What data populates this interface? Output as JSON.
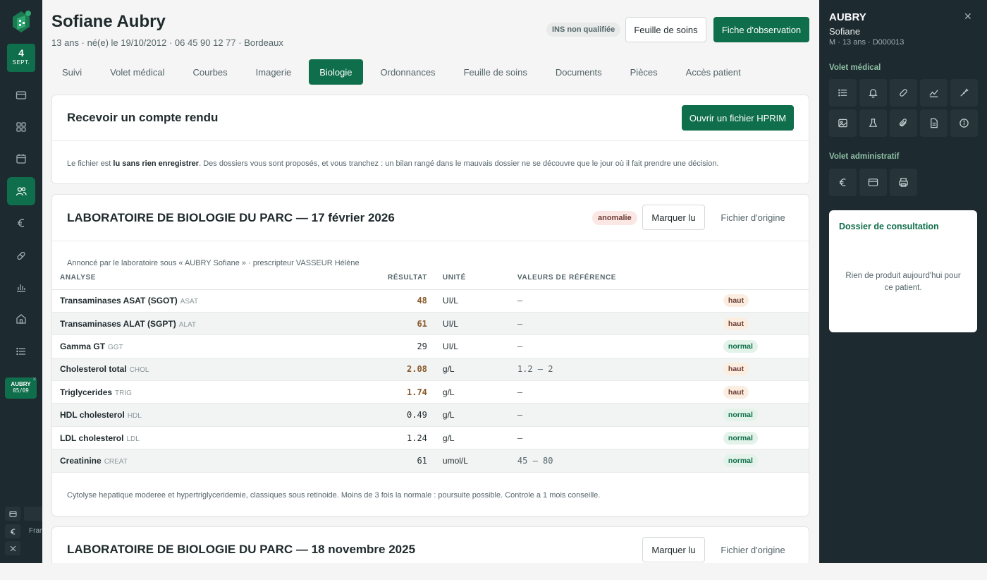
{
  "rail": {
    "date_day": "4",
    "date_month": "SEPT.",
    "patient_chip_name": "AUBRY",
    "patient_chip_date": "05/09",
    "lang_label": "Fran"
  },
  "patient": {
    "name": "Sofiane Aubry",
    "subtitle": "13 ans · né(e) le 19/10/2012 · 06 45 90 12 77 · Bordeaux",
    "ins_badge": "INS non qualifiée"
  },
  "header_buttons": {
    "feuille": "Feuille de soins",
    "fiche": "Fiche d'observation"
  },
  "tabs": [
    {
      "label": "Suivi"
    },
    {
      "label": "Volet médical"
    },
    {
      "label": "Courbes"
    },
    {
      "label": "Imagerie"
    },
    {
      "label": "Biologie"
    },
    {
      "label": "Ordonnances"
    },
    {
      "label": "Feuille de soins"
    },
    {
      "label": "Documents"
    },
    {
      "label": "Pièces"
    },
    {
      "label": "Accès patient"
    }
  ],
  "receive": {
    "title": "Recevoir un compte rendu",
    "button": "Ouvrir un fichier HPRIM",
    "text_before": "Le fichier est ",
    "text_bold": "lu sans rien enregistrer",
    "text_after": ". Des dossiers vous sont proposés, et vous tranchez : un bilan rangé dans le mauvais dossier ne se découvre que le jour où il fait prendre une décision."
  },
  "report1": {
    "title": "LABORATOIRE DE BIOLOGIE DU PARC — 17 février 2026",
    "badge": "anomalie",
    "mark_read": "Marquer lu",
    "origin": "Fichier d'origine",
    "announced": "Annoncé par le laboratoire sous « AUBRY Sofiane » · prescripteur VASSEUR Hélène",
    "headers": {
      "analyse": "ANALYSE",
      "resultat": "RÉSULTAT",
      "unite": "UNITÉ",
      "ref": "VALEURS DE RÉFÉRENCE"
    },
    "rows": [
      {
        "name": "Transaminases ASAT (SGOT)",
        "code": "ASAT",
        "value": "48",
        "unit": "UI/L",
        "ref": "–",
        "flag": "haut"
      },
      {
        "name": "Transaminases ALAT (SGPT)",
        "code": "ALAT",
        "value": "61",
        "unit": "UI/L",
        "ref": "–",
        "flag": "haut"
      },
      {
        "name": "Gamma GT",
        "code": "GGT",
        "value": "29",
        "unit": "UI/L",
        "ref": "–",
        "flag": "normal"
      },
      {
        "name": "Cholesterol total",
        "code": "CHOL",
        "value": "2.08",
        "unit": "g/L",
        "ref": "1.2 – 2",
        "flag": "haut"
      },
      {
        "name": "Triglycerides",
        "code": "TRIG",
        "value": "1.74",
        "unit": "g/L",
        "ref": "–",
        "flag": "haut"
      },
      {
        "name": "HDL cholesterol",
        "code": "HDL",
        "value": "0.49",
        "unit": "g/L",
        "ref": "–",
        "flag": "normal"
      },
      {
        "name": "LDL cholesterol",
        "code": "LDL",
        "value": "1.24",
        "unit": "g/L",
        "ref": "–",
        "flag": "normal"
      },
      {
        "name": "Creatinine",
        "code": "CREAT",
        "value": "61",
        "unit": "umol/L",
        "ref": "45 – 80",
        "flag": "normal"
      }
    ],
    "comment": "Cytolyse hepatique moderee et hypertriglyceridemie, classiques sous retinoide. Moins de 3 fois la normale : poursuite possible. Controle a 1 mois conseille."
  },
  "report2": {
    "title": "LABORATOIRE DE BIOLOGIE DU PARC — 18 novembre 2025",
    "mark_read": "Marquer lu",
    "origin": "Fichier d'origine"
  },
  "side": {
    "last_name": "AUBRY",
    "first_name": "Sofiane",
    "meta": "M · 13 ans · D000013",
    "volet_medical": "Volet médical",
    "volet_admin": "Volet administratif",
    "dossier_title": "Dossier de consultation",
    "dossier_empty": "Rien de produit aujourd'hui pour ce patient."
  },
  "colors": {
    "accent": "#0f6e4b",
    "dark": "#1d2a30"
  }
}
